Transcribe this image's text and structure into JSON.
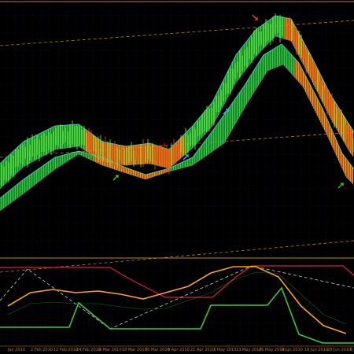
{
  "colors": {
    "background": "#000000",
    "grid": "#1a1a44",
    "bull": "#2ecc40",
    "bear": "#ff8c1a",
    "bull_bar": "#6fdc3a",
    "bear_bar": "#e03a10",
    "envelope_upper": "#40e0d0",
    "channel": "#c47a10",
    "separator": "#b8860b",
    "orange_line": "#ffa500",
    "green_line": "#33cc33",
    "red_line": "#dd1b3c",
    "dash_line": "#cccccc",
    "arrow_up_blue": "#29b6f6",
    "arrow_up_green": "#2ecc40",
    "arrow_down_red": "#ff3b3b",
    "axis_label": "#c47a10"
  },
  "icons": {
    "arrows": [
      "arrow-up-green-icon",
      "arrow-up-blue-icon",
      "arrow-up-blue-icon",
      "arrow-down-red-icon",
      "arrow-up-green-icon"
    ]
  },
  "x_axis": {
    "labels": [
      "Jan 2010",
      "2 Feb 2010",
      "12 Feb 2010",
      "24 Feb 2010",
      "8 Mar 2010",
      "18 Mar 2010",
      "30 Mar 2010",
      "9 Apr 2010",
      "21 Apr 2010",
      "3 May 2010",
      "13 May 2010",
      "25 May 2010",
      "4 Jun 2010",
      "16 Jun 2010",
      "28 Jun 2010",
      "8 Jul 20"
    ]
  },
  "chart_data": {
    "type": "line",
    "title": "",
    "xlabel": "",
    "ylabel": "",
    "x": [
      "Jan 2010",
      "2 Feb 2010",
      "12 Feb 2010",
      "24 Feb 2010",
      "8 Mar 2010",
      "18 Mar 2010",
      "30 Mar 2010",
      "9 Apr 2010",
      "21 Apr 2010",
      "3 May 2010",
      "13 May 2010",
      "25 May 2010",
      "4 Jun 2010",
      "16 Jun 2010",
      "28 Jun 2010",
      "8 Jul 20"
    ],
    "series": [
      {
        "values": [
          0.55,
          0.38,
          0.34,
          0.38,
          0.36,
          0.4,
          0.46,
          0.38,
          0.3,
          0.13,
          0.05,
          0.05,
          0.18,
          0.55,
          0.8,
          0.9
        ]
      },
      {
        "values": [
          0.66,
          0.52,
          0.5,
          0.52,
          0.52,
          0.56,
          0.59,
          0.58,
          0.48,
          0.38,
          0.22,
          0.12,
          0.14,
          0.4,
          0.66,
          0.78
        ]
      }
    ],
    "grid": true
  }
}
